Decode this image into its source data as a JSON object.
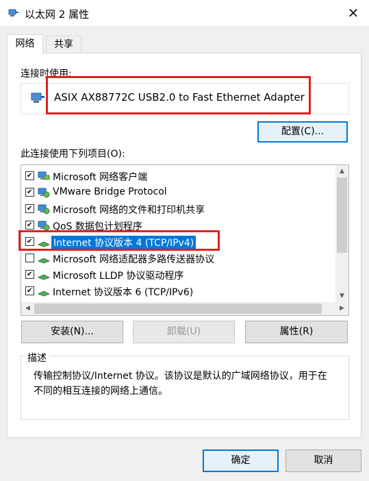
{
  "window": {
    "title": "以太网 2 属性",
    "close_glyph": "✕"
  },
  "tabs": [
    {
      "label": "网络"
    },
    {
      "label": "共享"
    }
  ],
  "connect_using": {
    "label": "连接时使用:",
    "adapter": "ASIX AX88772C USB2.0 to Fast Ethernet Adapter",
    "configure_button": "配置(C)..."
  },
  "items_section": {
    "label": "此连接使用下列项目(O):",
    "items": [
      {
        "label": "Microsoft 网络客户端",
        "checked": true,
        "icon": "network-client-icon"
      },
      {
        "label": "VMware Bridge Protocol",
        "checked": true,
        "icon": "network-service-icon"
      },
      {
        "label": "Microsoft 网络的文件和打印机共享",
        "checked": true,
        "icon": "network-service-icon"
      },
      {
        "label": "QoS 数据包计划程序",
        "checked": true,
        "icon": "network-service-icon"
      },
      {
        "label": "Internet 协议版本 4 (TCP/IPv4)",
        "checked": true,
        "selected": true,
        "icon": "protocol-icon"
      },
      {
        "label": "Microsoft 网络适配器多路传送器协议",
        "checked": false,
        "icon": "protocol-icon"
      },
      {
        "label": "Microsoft LLDP 协议驱动程序",
        "checked": true,
        "icon": "protocol-icon"
      },
      {
        "label": "Internet 协议版本 6 (TCP/IPv6)",
        "checked": true,
        "icon": "protocol-icon"
      }
    ]
  },
  "buttons": {
    "install": "安装(N)...",
    "uninstall": "卸载(U)",
    "properties": "属性(R)"
  },
  "description": {
    "title": "描述",
    "text": "传输控制协议/Internet 协议。该协议是默认的广域网络协议，用于在不同的相互连接的网络上通信。"
  },
  "footer": {
    "ok": "确定",
    "cancel": "取消"
  },
  "colors": {
    "accent": "#0078d7",
    "highlight_box": "#e02020"
  }
}
